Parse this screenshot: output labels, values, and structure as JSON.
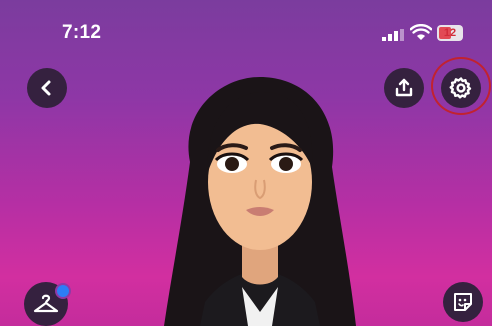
{
  "status_bar": {
    "time": "7:12",
    "battery_level": "12",
    "battery_color": "#e24a55"
  },
  "toolbar": {
    "back_icon": "chevron-left-icon",
    "share_icon": "share-upload-icon",
    "settings_icon": "gear-icon",
    "settings_highlight_color": "#c2222f"
  },
  "bottom_bar": {
    "outfit_icon": "hanger-icon",
    "outfit_notification_color": "#2d7df7",
    "sticker_icon": "sticker-face-icon"
  },
  "background": {
    "top_color": "#7b3c9e",
    "bottom_color": "#d22fa0"
  },
  "avatar": {
    "subject": "bitmoji-avatar"
  }
}
